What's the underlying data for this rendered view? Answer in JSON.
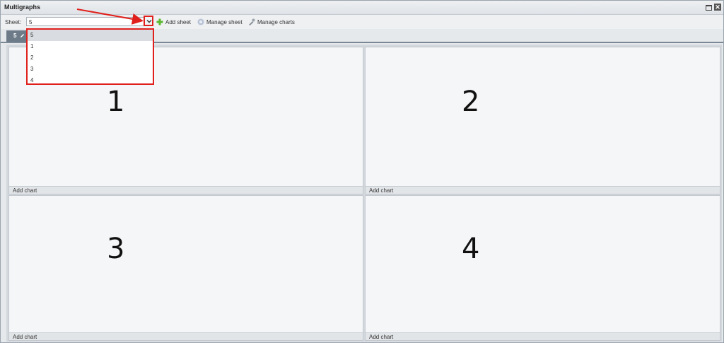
{
  "window": {
    "title": "Multigraphs"
  },
  "toolbar": {
    "sheet_label": "Sheet:",
    "sheet_value": "5",
    "add_sheet": "Add sheet",
    "manage_sheet": "Manage sheet",
    "manage_charts": "Manage charts"
  },
  "tab": {
    "label": "5"
  },
  "dropdown": {
    "options": [
      "5",
      "1",
      "2",
      "3",
      "4"
    ],
    "selected": "5"
  },
  "panels": [
    {
      "number": "1",
      "footer": "Add chart"
    },
    {
      "number": "2",
      "footer": "Add chart"
    },
    {
      "number": "3",
      "footer": "Add chart"
    },
    {
      "number": "4",
      "footer": "Add chart"
    }
  ],
  "colors": {
    "highlight": "#e0201c",
    "tab": "#6d7b89"
  }
}
